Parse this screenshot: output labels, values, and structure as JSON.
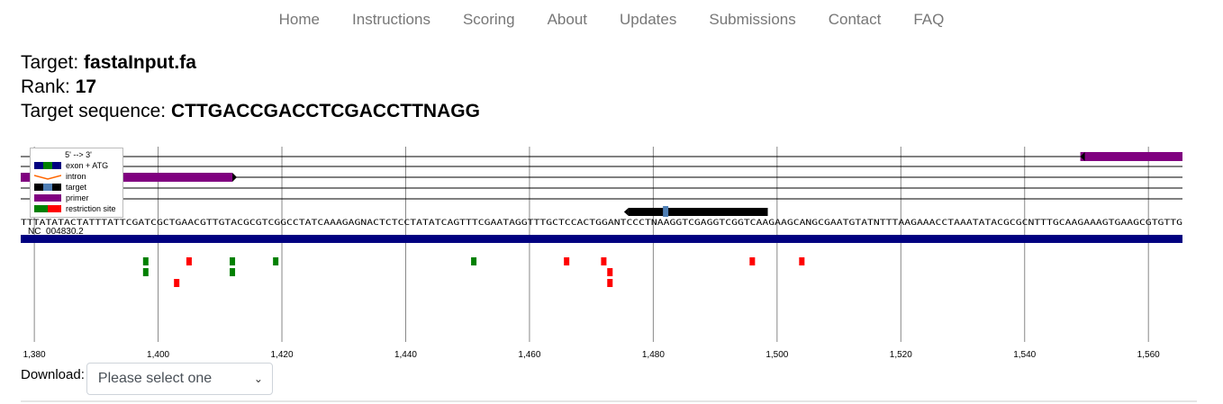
{
  "nav": {
    "items": [
      "Home",
      "Instructions",
      "Scoring",
      "About",
      "Updates",
      "Submissions",
      "Contact",
      "FAQ"
    ]
  },
  "target": {
    "target_label": "Target: ",
    "target_value": "fastaInput.fa",
    "rank_label": "Rank: ",
    "rank_value": "17",
    "sequence_label": "Target sequence: ",
    "sequence_value": "CTTGACCGACCTCGACCTTNAGG"
  },
  "legend": {
    "header": "5' --> 3'",
    "items": [
      {
        "label": "exon + ATG",
        "colors": [
          "#000080",
          "#008000",
          "#000080"
        ]
      },
      {
        "label": "intron",
        "colors": [
          "#ff6600"
        ]
      },
      {
        "label": "target",
        "colors": [
          "#000000",
          "#4f7fb5",
          "#000000"
        ]
      },
      {
        "label": "primer",
        "colors": [
          "#800080"
        ]
      },
      {
        "label": "restriction site",
        "colors": [
          "#008000",
          "#ff0000"
        ]
      }
    ]
  },
  "track": {
    "chromosome": "NC_004830.2",
    "sequence": "TTTATATACTATTTATTCGATCGCTGAACGTTGTACGCGTCGGCCTATCAAAGAGNACTCTCCTATATCAGTTTCGAATAGGTTTGCTCCACTGGANTCCCTNAAGGTCGAGGTCGGTCAAGAAGCANGCGAATGTATNTTTAAGAAACCTAAATATACGCGCNTTTGCAAGAAAGTGAAGCGTGTTG",
    "axis_ticks": [
      "1,380",
      "1,400",
      "1,420",
      "1,440",
      "1,460",
      "1,480",
      "1,500",
      "1,520",
      "1,540",
      "1,560"
    ],
    "axis_values": [
      1380,
      1400,
      1420,
      1440,
      1460,
      1480,
      1500,
      1520,
      1540,
      1560
    ],
    "x_range": [
      1377.8,
      1565.5
    ],
    "colors": {
      "exon": "#000080",
      "primer": "#800080",
      "target": "#000000",
      "target_pam": "#4f7fb5",
      "site_green": "#008000",
      "site_red": "#ff0000"
    },
    "primers": [
      {
        "start": 1549,
        "end": 1565.5,
        "lane": 0
      },
      {
        "start": 1377.8,
        "end": 1412,
        "lane": 2
      }
    ],
    "target_region": {
      "start": 1476,
      "end": 1498.5,
      "pam_at": 1482
    },
    "restriction_sites": [
      {
        "pos": 1398,
        "row": 0,
        "color": "green"
      },
      {
        "pos": 1398,
        "row": 1,
        "color": "green"
      },
      {
        "pos": 1405,
        "row": 0,
        "color": "red"
      },
      {
        "pos": 1403,
        "row": 2,
        "color": "red"
      },
      {
        "pos": 1412,
        "row": 0,
        "color": "green"
      },
      {
        "pos": 1412,
        "row": 1,
        "color": "green"
      },
      {
        "pos": 1419,
        "row": 0,
        "color": "green"
      },
      {
        "pos": 1451,
        "row": 0,
        "color": "green"
      },
      {
        "pos": 1466,
        "row": 0,
        "color": "red"
      },
      {
        "pos": 1472,
        "row": 0,
        "color": "red"
      },
      {
        "pos": 1473,
        "row": 1,
        "color": "red"
      },
      {
        "pos": 1473,
        "row": 2,
        "color": "red"
      },
      {
        "pos": 1496,
        "row": 0,
        "color": "red"
      },
      {
        "pos": 1504,
        "row": 0,
        "color": "red"
      }
    ]
  },
  "download": {
    "label": "Download:",
    "select_value": "Please select one"
  }
}
